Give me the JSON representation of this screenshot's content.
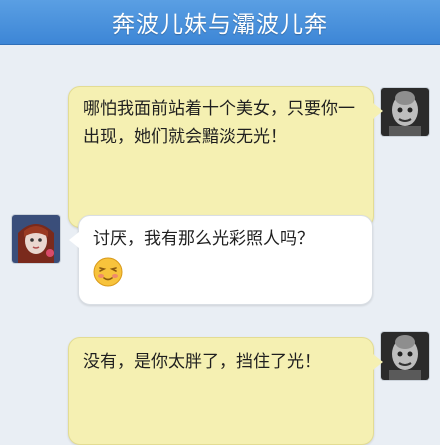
{
  "header": {
    "title": "奔波儿妹与灞波儿奔"
  },
  "messages": [
    {
      "sender": "right",
      "text": "哪怕我面前站着十个美女，只要你一出现，她们就会黯淡无光！"
    },
    {
      "sender": "left",
      "text": "讨厌，我有那么光彩照人吗？",
      "emoji": "shy-smile-emoji"
    },
    {
      "sender": "right",
      "text": "没有，是你太胖了，挡住了光！"
    }
  ],
  "colors": {
    "header": "#3d86d6",
    "background": "#e9eef4",
    "bubble_outgoing": "#f5f0b2",
    "bubble_incoming": "#ffffff"
  }
}
